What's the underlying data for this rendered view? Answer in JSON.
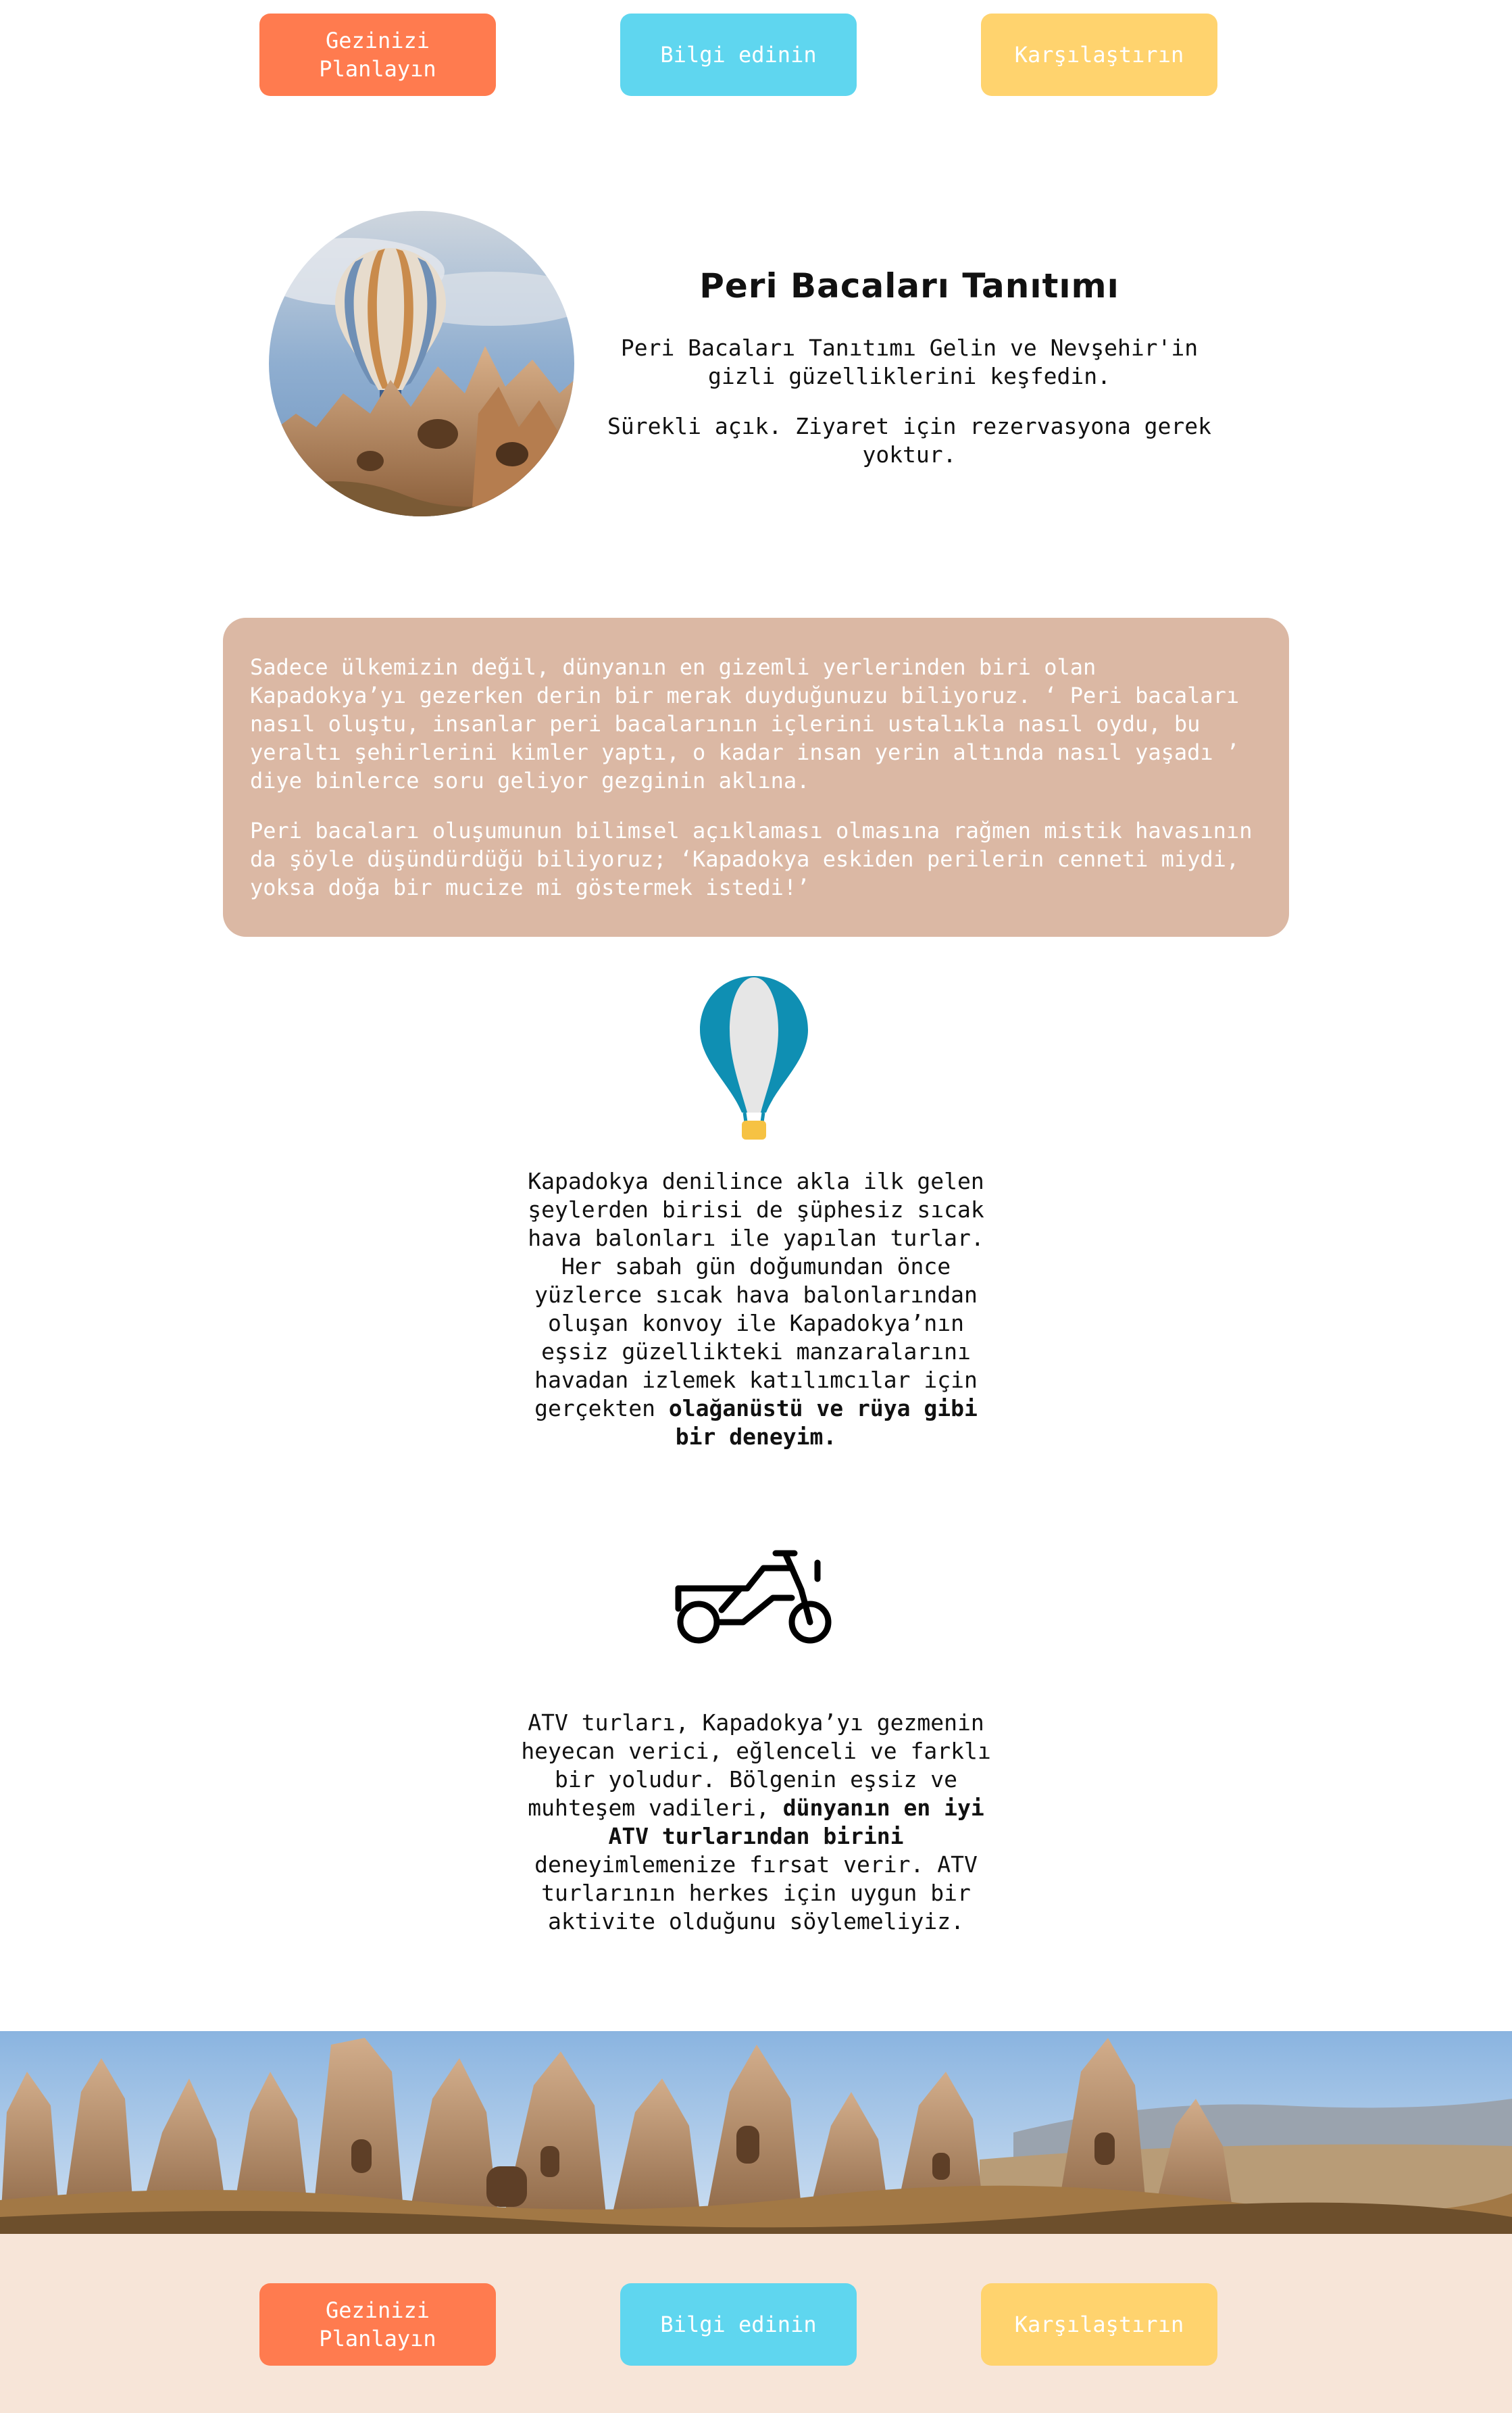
{
  "top_buttons": {
    "plan": "Gezinizi Planlayın",
    "info": "Bilgi edinin",
    "compare": "Karşılaştırın"
  },
  "hero": {
    "title": "Peri Bacaları Tanıtımı",
    "subtitle": "Peri Bacaları Tanıtımı Gelin ve Nevşehir'in gizli güzelliklerini keşfedin.",
    "note": "Sürekli açık. Ziyaret için rezervasyona gerek yoktur."
  },
  "info_card": {
    "paragraph_1": "Sadece ülkemizin değil, dünyanın en gizemli yerlerinden biri olan Kapadokya’yı gezerken derin bir merak duyduğunuzu biliyoruz. ‘ Peri bacaları nasıl oluştu, insanlar peri bacalarının içlerini ustalıkla nasıl oydu, bu yeraltı şehirlerini kimler yaptı, o kadar insan yerin altında nasıl yaşadı ’ diye binlerce soru geliyor gezginin aklına.",
    "paragraph_2": "Peri bacaları oluşumunun bilimsel açıklaması olmasına rağmen mistik havasının da şöyle düşündürdüğü biliyoruz; ‘Kapadokya eskiden perilerin cenneti miydi, yoksa doğa bir mucize mi göstermek istedi!’"
  },
  "balloon_section": {
    "icon": "hot-air-balloon-icon",
    "text": "Kapadokya denilince akla ilk gelen şeylerden birisi de şüphesiz sıcak hava balonları ile yapılan turlar. Her sabah gün doğumundan önce yüzlerce sıcak hava balonlarından oluşan konvoy ile Kapadokya’nın eşsiz güzellikteki manzaralarını havadan izlemek katılımcılar için gerçekten",
    "text_bold": "olağanüstü ve rüya gibi bir deneyim."
  },
  "atv_section": {
    "icon": "motorcycle-icon",
    "text_start": "ATV turları, Kapadokya’yı gezmenin heyecan verici, eğlenceli ve farklı bir yoludur. Bölgenin eşsiz ve muhteşem vadileri,",
    "text_bold": "dünyanın en iyi ATV turlarından birini",
    "text_end": "deneyimlemenize fırsat verir. ATV turlarının herkes için uygun bir aktivite olduğunu söylemeliyiz."
  },
  "bottom_buttons": {
    "plan": "Gezinizi Planlayın",
    "info": "Bilgi edinin",
    "compare": "Karşılaştırın"
  },
  "colors": {
    "plan_button": "#ff7b4f",
    "info_button": "#5fd6ef",
    "compare_button": "#ffd36e",
    "info_card": "#dbb8a4",
    "footer_band": "#f7e5d8"
  }
}
